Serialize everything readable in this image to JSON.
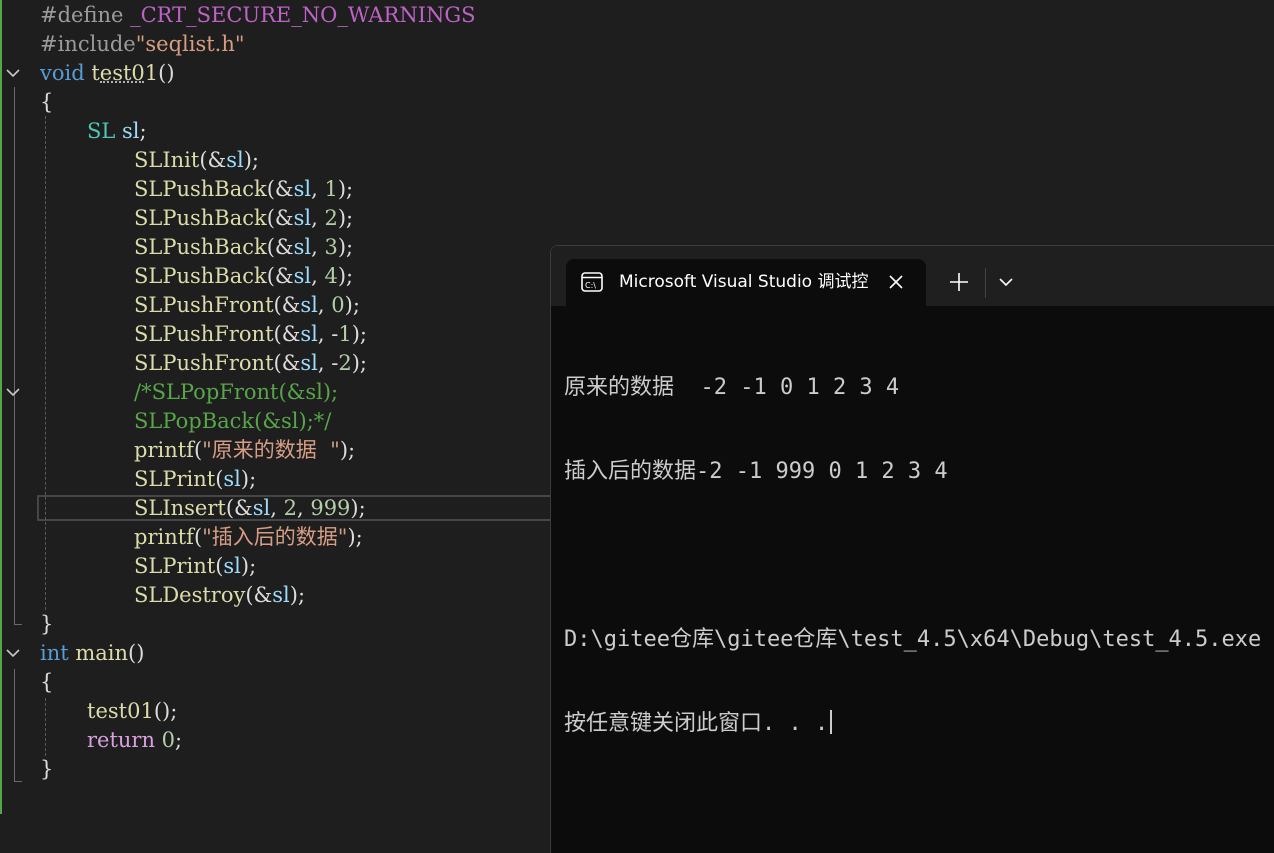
{
  "editor": {
    "lines": [
      {
        "id": "l1",
        "tokens": [
          {
            "c": "pp",
            "t": "#define "
          },
          {
            "c": "mac",
            "t": "_CRT_SECURE_NO_WARNINGS"
          }
        ]
      },
      {
        "id": "l2",
        "tokens": [
          {
            "c": "pp",
            "t": "#include"
          },
          {
            "c": "str",
            "t": "\"seqlist.h\""
          }
        ]
      },
      {
        "id": "l3",
        "tokens": [
          {
            "c": "kw",
            "t": "void "
          },
          {
            "c": "fn",
            "t": "test01"
          },
          {
            "c": "plain",
            "t": "()"
          }
        ]
      },
      {
        "id": "l4",
        "tokens": [
          {
            "c": "plain",
            "t": "{"
          }
        ]
      },
      {
        "id": "l5",
        "tokens": [
          {
            "c": "ty",
            "t": "SL "
          },
          {
            "c": "var",
            "t": "sl"
          },
          {
            "c": "plain",
            "t": ";"
          }
        ]
      },
      {
        "id": "l6",
        "tokens": [
          {
            "c": "fn",
            "t": "SLInit"
          },
          {
            "c": "plain",
            "t": "(&"
          },
          {
            "c": "var",
            "t": "sl"
          },
          {
            "c": "plain",
            "t": ");"
          }
        ]
      },
      {
        "id": "l7",
        "tokens": [
          {
            "c": "fn",
            "t": "SLPushBack"
          },
          {
            "c": "plain",
            "t": "(&"
          },
          {
            "c": "var",
            "t": "sl"
          },
          {
            "c": "plain",
            "t": ", "
          },
          {
            "c": "num",
            "t": "1"
          },
          {
            "c": "plain",
            "t": ");"
          }
        ]
      },
      {
        "id": "l8",
        "tokens": [
          {
            "c": "fn",
            "t": "SLPushBack"
          },
          {
            "c": "plain",
            "t": "(&"
          },
          {
            "c": "var",
            "t": "sl"
          },
          {
            "c": "plain",
            "t": ", "
          },
          {
            "c": "num",
            "t": "2"
          },
          {
            "c": "plain",
            "t": ");"
          }
        ]
      },
      {
        "id": "l9",
        "tokens": [
          {
            "c": "fn",
            "t": "SLPushBack"
          },
          {
            "c": "plain",
            "t": "(&"
          },
          {
            "c": "var",
            "t": "sl"
          },
          {
            "c": "plain",
            "t": ", "
          },
          {
            "c": "num",
            "t": "3"
          },
          {
            "c": "plain",
            "t": ");"
          }
        ]
      },
      {
        "id": "l10",
        "tokens": [
          {
            "c": "fn",
            "t": "SLPushBack"
          },
          {
            "c": "plain",
            "t": "(&"
          },
          {
            "c": "var",
            "t": "sl"
          },
          {
            "c": "plain",
            "t": ", "
          },
          {
            "c": "num",
            "t": "4"
          },
          {
            "c": "plain",
            "t": ");"
          }
        ]
      },
      {
        "id": "l11",
        "tokens": [
          {
            "c": "fn",
            "t": "SLPushFront"
          },
          {
            "c": "plain",
            "t": "(&"
          },
          {
            "c": "var",
            "t": "sl"
          },
          {
            "c": "plain",
            "t": ", "
          },
          {
            "c": "num",
            "t": "0"
          },
          {
            "c": "plain",
            "t": ");"
          }
        ]
      },
      {
        "id": "l12",
        "tokens": [
          {
            "c": "fn",
            "t": "SLPushFront"
          },
          {
            "c": "plain",
            "t": "(&"
          },
          {
            "c": "var",
            "t": "sl"
          },
          {
            "c": "plain",
            "t": ", -"
          },
          {
            "c": "num",
            "t": "1"
          },
          {
            "c": "plain",
            "t": ");"
          }
        ]
      },
      {
        "id": "l13",
        "tokens": [
          {
            "c": "fn",
            "t": "SLPushFront"
          },
          {
            "c": "plain",
            "t": "(&"
          },
          {
            "c": "var",
            "t": "sl"
          },
          {
            "c": "plain",
            "t": ", -"
          },
          {
            "c": "num",
            "t": "2"
          },
          {
            "c": "plain",
            "t": ");"
          }
        ]
      },
      {
        "id": "l14",
        "tokens": [
          {
            "c": "cm",
            "t": "/*SLPopFront(&sl);"
          }
        ]
      },
      {
        "id": "l15",
        "tokens": [
          {
            "c": "cm",
            "t": "SLPopBack(&sl);*/"
          }
        ]
      },
      {
        "id": "l16",
        "tokens": [
          {
            "c": "fn",
            "t": "printf"
          },
          {
            "c": "plain",
            "t": "("
          },
          {
            "c": "str",
            "t": "\"原来的数据  \""
          },
          {
            "c": "plain",
            "t": ");"
          }
        ]
      },
      {
        "id": "l17",
        "tokens": [
          {
            "c": "fn",
            "t": "SLPrint"
          },
          {
            "c": "plain",
            "t": "("
          },
          {
            "c": "var",
            "t": "sl"
          },
          {
            "c": "plain",
            "t": ");"
          }
        ]
      },
      {
        "id": "l18",
        "tokens": [
          {
            "c": "fn",
            "t": "SLInsert"
          },
          {
            "c": "plain",
            "t": "(&"
          },
          {
            "c": "var",
            "t": "sl"
          },
          {
            "c": "plain",
            "t": ", "
          },
          {
            "c": "num",
            "t": "2"
          },
          {
            "c": "plain",
            "t": ", "
          },
          {
            "c": "num",
            "t": "999"
          },
          {
            "c": "plain",
            "t": ");"
          }
        ]
      },
      {
        "id": "l19",
        "tokens": [
          {
            "c": "fn",
            "t": "printf"
          },
          {
            "c": "plain",
            "t": "("
          },
          {
            "c": "str",
            "t": "\"插入后的数据\""
          },
          {
            "c": "plain",
            "t": ");"
          }
        ]
      },
      {
        "id": "l20",
        "tokens": [
          {
            "c": "fn",
            "t": "SLPrint"
          },
          {
            "c": "plain",
            "t": "("
          },
          {
            "c": "var",
            "t": "sl"
          },
          {
            "c": "plain",
            "t": ");"
          }
        ]
      },
      {
        "id": "l21",
        "tokens": [
          {
            "c": "fn",
            "t": "SLDestroy"
          },
          {
            "c": "plain",
            "t": "(&"
          },
          {
            "c": "var",
            "t": "sl"
          },
          {
            "c": "plain",
            "t": ");"
          }
        ]
      },
      {
        "id": "l22",
        "tokens": [
          {
            "c": "plain",
            "t": "}"
          }
        ]
      },
      {
        "id": "l23",
        "tokens": [
          {
            "c": "kw",
            "t": "int "
          },
          {
            "c": "fn",
            "t": "main"
          },
          {
            "c": "plain",
            "t": "()"
          }
        ]
      },
      {
        "id": "l24",
        "tokens": [
          {
            "c": "plain",
            "t": "{"
          }
        ]
      },
      {
        "id": "l25",
        "tokens": [
          {
            "c": "fn",
            "t": "test01"
          },
          {
            "c": "plain",
            "t": "();"
          }
        ]
      },
      {
        "id": "l26",
        "tokens": [
          {
            "c": "ctl",
            "t": "return "
          },
          {
            "c": "num",
            "t": "0"
          },
          {
            "c": "plain",
            "t": ";"
          }
        ]
      },
      {
        "id": "l27",
        "tokens": [
          {
            "c": "plain",
            "t": "}"
          }
        ]
      }
    ]
  },
  "terminal": {
    "tab_title": "Microsoft Visual Studio 调试控制台",
    "tab_icon": "terminal-icon",
    "close_icon": "close-icon",
    "new_tab_icon": "plus-icon",
    "dropdown_icon": "chevron-down-icon",
    "output": [
      "原来的数据  -2 -1 0 1 2 3 4",
      "插入后的数据-2 -1 999 0 1 2 3 4",
      "",
      "D:\\gitee仓库\\gitee仓库\\test_4.5\\x64\\Debug\\test_4.5.exe",
      "按任意键关闭此窗口. . ."
    ]
  }
}
